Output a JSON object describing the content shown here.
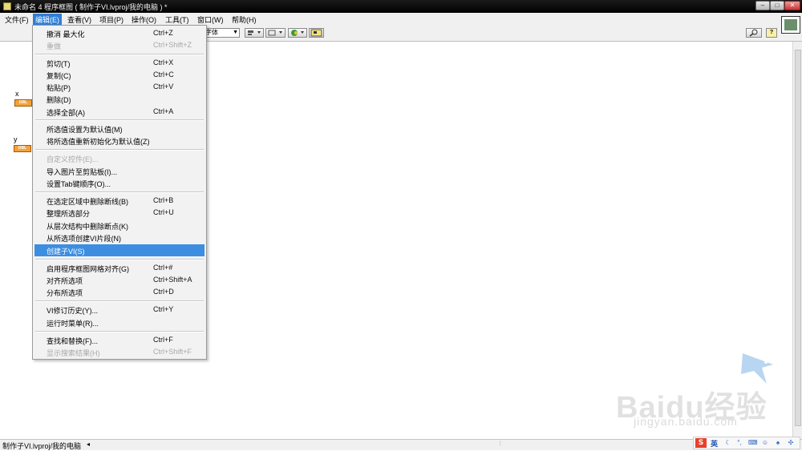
{
  "window": {
    "title": "未命名 4 程序框图 ( 制作子VI.lvproj/我的电脑 ) *",
    "minimize": "–",
    "maximize": "□",
    "close": "✕"
  },
  "menubar": {
    "file": "文件(F)",
    "edit": "编辑(E)",
    "view": "查看(V)",
    "project": "项目(P)",
    "operate": "操作(O)",
    "tools": "工具(T)",
    "window": "窗口(W)",
    "help": "帮助(H)"
  },
  "toolbar": {
    "font": "字体",
    "help_label": "?",
    "search_icon": "search-icon",
    "help_icon": "help-icon"
  },
  "edit_menu": {
    "items": [
      {
        "label": "撤消 最大化",
        "shortcut": "Ctrl+Z",
        "disabled": false
      },
      {
        "label": "重做",
        "shortcut": "Ctrl+Shift+Z",
        "disabled": true
      },
      {
        "label": "剪切(T)",
        "shortcut": "Ctrl+X",
        "disabled": false
      },
      {
        "label": "复制(C)",
        "shortcut": "Ctrl+C",
        "disabled": false
      },
      {
        "label": "粘贴(P)",
        "shortcut": "Ctrl+V",
        "disabled": false
      },
      {
        "label": "删除(D)",
        "shortcut": "",
        "disabled": false
      },
      {
        "label": "选择全部(A)",
        "shortcut": "Ctrl+A",
        "disabled": false
      },
      {
        "label": "所选值设置为默认值(M)",
        "shortcut": "",
        "disabled": false
      },
      {
        "label": "将所选值重新初始化为默认值(Z)",
        "shortcut": "",
        "disabled": false
      },
      {
        "label": "自定义控件(E)...",
        "shortcut": "",
        "disabled": true
      },
      {
        "label": "导入图片至剪贴板(I)...",
        "shortcut": "",
        "disabled": false
      },
      {
        "label": "设置Tab键顺序(O)...",
        "shortcut": "",
        "disabled": false
      },
      {
        "label": "在选定区域中删除断线(B)",
        "shortcut": "Ctrl+B",
        "disabled": false
      },
      {
        "label": "整理所选部分",
        "shortcut": "Ctrl+U",
        "disabled": false
      },
      {
        "label": "从层次结构中删除断点(K)",
        "shortcut": "",
        "disabled": false
      },
      {
        "label": "从所选项创建VI片段(N)",
        "shortcut": "",
        "disabled": false
      },
      {
        "label": "创建子VI(S)",
        "shortcut": "",
        "disabled": false,
        "highlighted": true
      },
      {
        "label": "启用程序框图网格对齐(G)",
        "shortcut": "Ctrl+#",
        "disabled": false
      },
      {
        "label": "对齐所选项",
        "shortcut": "Ctrl+Shift+A",
        "disabled": false
      },
      {
        "label": "分布所选项",
        "shortcut": "Ctrl+D",
        "disabled": false
      },
      {
        "label": "VI修订历史(Y)...",
        "shortcut": "Ctrl+Y",
        "disabled": false
      },
      {
        "label": "运行时菜单(R)...",
        "shortcut": "",
        "disabled": false
      },
      {
        "label": "查找和替换(F)...",
        "shortcut": "Ctrl+F",
        "disabled": false
      },
      {
        "label": "显示搜索结果(H)",
        "shortcut": "Ctrl+Shift+F",
        "disabled": true
      }
    ]
  },
  "diagram": {
    "terminals": [
      {
        "label": "x",
        "type": "DBL"
      },
      {
        "label": "y",
        "type": "DBL"
      }
    ]
  },
  "statusbar": {
    "path": "制作子VI.lvproj/我的电脑",
    "arrow": "◂",
    "grip": "⦙"
  },
  "ime": {
    "logo": "S",
    "lang": "英"
  },
  "watermark": {
    "brand": "Baidu经验",
    "url": "jingyan.baidu.com"
  },
  "colors": {
    "menu_highlight": "#3d8ee0",
    "terminal_orange": "#f3a23a"
  }
}
